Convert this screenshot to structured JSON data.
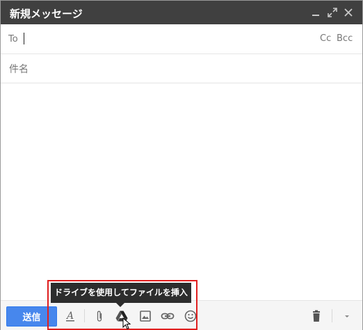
{
  "window": {
    "title": "新規メッセージ"
  },
  "titlebar": {
    "minimize_icon": "minimize-icon",
    "expand_icon": "expand-icon",
    "close_icon": "close-icon",
    "background": "#404040"
  },
  "to_field": {
    "label": "To",
    "value": ""
  },
  "cc_label": "Cc",
  "bcc_label": "Bcc",
  "subject": {
    "placeholder": "件名",
    "value": ""
  },
  "toolbar": {
    "send_label": "送信",
    "send_color": "#4787ed",
    "icons": [
      "format-text-icon",
      "attach-icon",
      "drive-icon",
      "photo-icon",
      "link-icon",
      "emoji-icon",
      "trash-icon",
      "more-options-icon"
    ]
  },
  "tooltip": {
    "text": "ドライブを使用してファイルを挿入"
  },
  "highlight_color": "#e01e1e"
}
